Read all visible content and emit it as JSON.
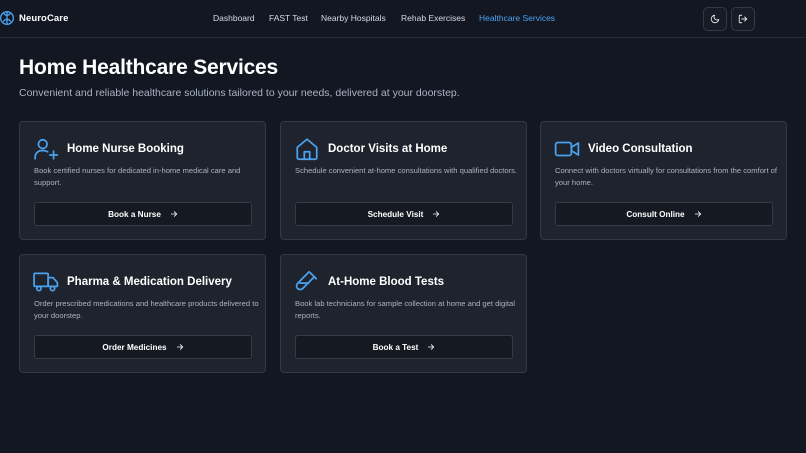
{
  "brand": {
    "name": "NeuroCare",
    "icon": "brain-icon"
  },
  "nav": {
    "items": [
      "Dashboard",
      "FAST Test",
      "Nearby Hospitals",
      "Rehab Exercises",
      "Healthcare Services"
    ],
    "active": "Healthcare Services"
  },
  "header_actions": {
    "theme_icon": "moon-icon",
    "logout_icon": "logout-icon"
  },
  "colors": {
    "background": "#131722",
    "card": "#1f232d",
    "accent": "#4aa3f0",
    "border": "#323844"
  },
  "page": {
    "title": "Home Healthcare Services",
    "subtitle": "Convenient and reliable healthcare solutions tailored to your needs, delivered at your doorstep."
  },
  "cards": [
    {
      "icon": "user-plus-icon",
      "title": "Home Nurse Booking",
      "description": "Book certified nurses for dedicated in-home medical care and support.",
      "button": "Book a Nurse"
    },
    {
      "icon": "home-icon",
      "title": "Doctor Visits at Home",
      "description": "Schedule convenient at-home consultations with qualified doctors.",
      "button": "Schedule Visit"
    },
    {
      "icon": "video-icon",
      "title": "Video Consultation",
      "description": "Connect with doctors virtually for consultations from the comfort of your home.",
      "button": "Consult Online"
    },
    {
      "icon": "truck-icon",
      "title": "Pharma & Medication Delivery",
      "description": "Order prescribed medications and healthcare products delivered to your doorstep.",
      "button": "Order Medicines"
    },
    {
      "icon": "test-tube-icon",
      "title": "At-Home Blood Tests",
      "description": "Book lab technicians for sample collection at home and get digital reports.",
      "button": "Book a Test"
    }
  ]
}
